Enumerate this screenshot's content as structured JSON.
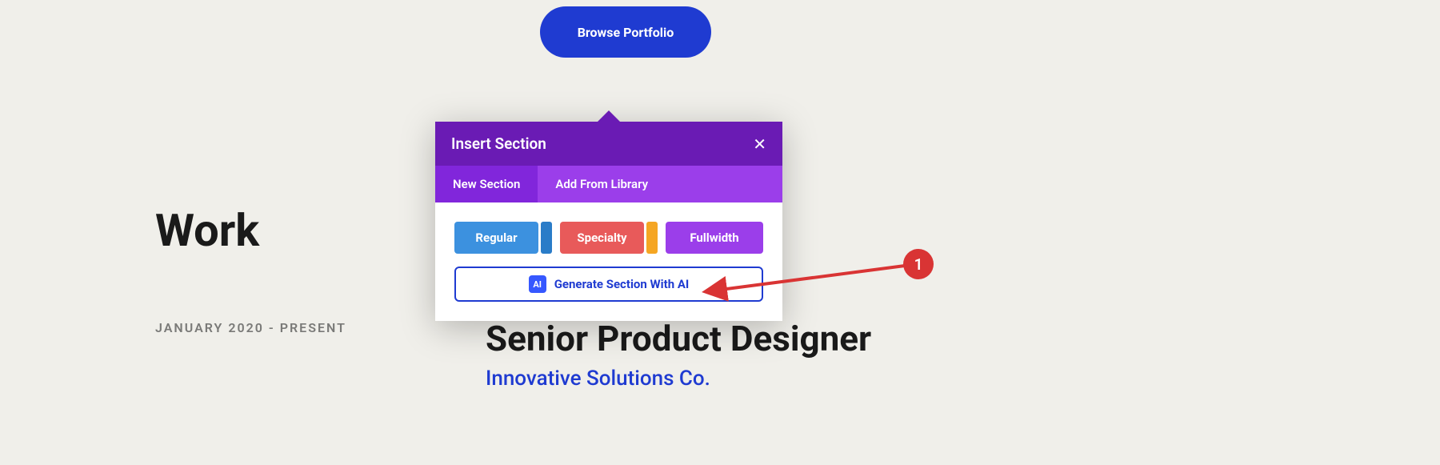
{
  "browse_button": {
    "label": "Browse Portfolio"
  },
  "work": {
    "heading": "Work",
    "date_range": "JANUARY 2020 - PRESENT",
    "job_title": "Senior Product Designer",
    "company": "Innovative Solutions Co."
  },
  "panel": {
    "title": "Insert Section",
    "tabs": {
      "new_section": "New Section",
      "add_library": "Add From Library"
    },
    "buttons": {
      "regular": "Regular",
      "specialty": "Specialty",
      "fullwidth": "Fullwidth"
    },
    "ai_button": {
      "icon_label": "AI",
      "label": "Generate Section With AI"
    }
  },
  "annotation": {
    "number": "1"
  }
}
